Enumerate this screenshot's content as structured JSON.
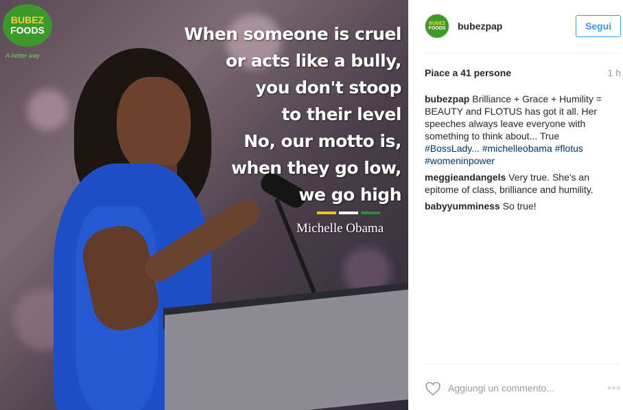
{
  "photo": {
    "logo": {
      "line1": "BUBEZ",
      "line2": "FOODS",
      "tagline": "A better way"
    },
    "quote_lines": [
      "When someone is cruel",
      "or acts like a bully,",
      "you don't stoop",
      "to their level",
      "No, our motto is,",
      "when they go low,",
      "we go high"
    ],
    "author": "Michelle Obama",
    "flag_colors": [
      "#f0c419",
      "#ffffff",
      "#2a8f3a"
    ]
  },
  "header": {
    "avatar": {
      "line1": "BUBEZ",
      "line2": "FOODS"
    },
    "username": "bubezpap",
    "follow_label": "Segui"
  },
  "stats": {
    "likes_label": "Piace a 41 persone",
    "time": "1 h"
  },
  "caption": {
    "user": "bubezpap",
    "text": "Brilliance + Grace + Humility = BEAUTY and FLOTUS has got it all. Her speeches always leave everyone with something to think about... True",
    "hashtags": [
      "#BossLady...",
      "#michelleobama",
      "#flotus",
      "#womeninpower"
    ]
  },
  "comments": [
    {
      "user": "meggieandangels",
      "text": "Very true. She's an epitome of class, brilliance and humility."
    },
    {
      "user": "babyyumminess",
      "text": "So true!"
    }
  ],
  "footer": {
    "add_comment_placeholder": "Aggiungi un commento...",
    "more_label": "◦◦◦"
  },
  "icons": {
    "like": "heart-icon",
    "options": "more-options-icon"
  },
  "colors": {
    "accent": "#3897f0",
    "hashtag": "#003569",
    "muted": "#999999",
    "dress": "#1f4fc7",
    "logo_green": "#3c9a2a"
  }
}
